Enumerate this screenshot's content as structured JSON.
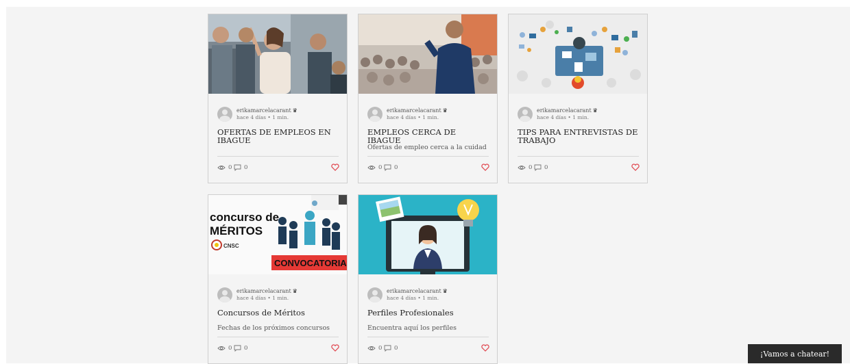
{
  "posts": [
    {
      "author": "erikamarcelacarant",
      "date": "hace 4 días",
      "read_time": "1 min.",
      "title": "OFERTAS DE EMPLEOS EN IBAGUE",
      "excerpt": "",
      "views": "0",
      "comments": "0",
      "image": "people-office-whiteboard"
    },
    {
      "author": "erikamarcelacarant",
      "date": "hace 4 días",
      "read_time": "1 min.",
      "title": "EMPLEOS CERCA DE IBAGUE",
      "excerpt": "Ofertas de empleo cerca a la cuidad",
      "views": "0",
      "comments": "0",
      "image": "speaker-audience"
    },
    {
      "author": "erikamarcelacarant",
      "date": "hace 4 días",
      "read_time": "1 min.",
      "title": "TIPS PARA ENTREVISTAS DE TRABAJO",
      "excerpt": "",
      "views": "0",
      "comments": "0",
      "image": "desk-icons-illustration"
    },
    {
      "author": "erikamarcelacarant",
      "date": "hace 4 días",
      "read_time": "1 min.",
      "title": "Concursos de Méritos",
      "excerpt": "Fechas de los próximos concursos",
      "views": "0",
      "comments": "0",
      "image": "concurso-de-meritos",
      "image_text": {
        "line1": "concurso de",
        "line2": "MÉRITOS",
        "badge": "CNSC",
        "banner": "CONVOCATORIA"
      }
    },
    {
      "author": "erikamarcelacarant",
      "date": "hace 4 días",
      "read_time": "1 min.",
      "title": "Perfiles Profesionales",
      "excerpt": "Encuentra aquí los perfiles",
      "views": "0",
      "comments": "0",
      "image": "monitor-profile-illustration"
    }
  ],
  "separator": "•",
  "chat_button": "¡Vamos a chatear!",
  "colors": {
    "background": "#f4f4f4",
    "heart": "#e0454d",
    "chat_button": "#2a2a2a",
    "card_border": "#cfcfcf"
  }
}
